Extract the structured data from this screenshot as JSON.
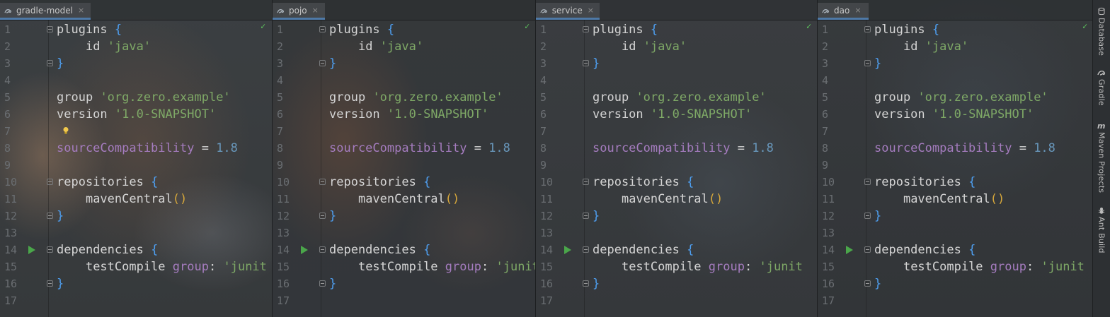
{
  "panes": [
    {
      "tab": "gradle-model",
      "close": "×",
      "show_bulb": true
    },
    {
      "tab": "pojo",
      "close": "×",
      "show_bulb": false
    },
    {
      "tab": "service",
      "close": "×",
      "show_bulb": false
    },
    {
      "tab": "dao",
      "close": "×",
      "show_bulb": false
    }
  ],
  "code": {
    "plugins": "plugins",
    "open_brace": "{",
    "close_brace": "}",
    "id": "id",
    "java": "'java'",
    "group": "group",
    "group_val": "'org.zero.example'",
    "version": "version",
    "version_val": "'1.0-SNAPSHOT'",
    "sourceCompat": "sourceCompatibility",
    "eq": " = ",
    "compat_val": "1.8",
    "repositories": "repositories",
    "mavenCentral": "mavenCentral",
    "lparen": "(",
    "rparen": ")",
    "dependencies": "dependencies",
    "testCompile": "testCompile",
    "group_named": "group",
    "colon": ":",
    "junit_partial": "'junit"
  },
  "line_numbers": [
    "1",
    "2",
    "3",
    "4",
    "5",
    "6",
    "7",
    "8",
    "9",
    "10",
    "11",
    "12",
    "13",
    "14",
    "15",
    "16",
    "17"
  ],
  "sidebar": [
    {
      "label": "Database",
      "icon": "database-icon"
    },
    {
      "label": "Gradle",
      "icon": "gradle-icon"
    },
    {
      "label": "Maven Projects",
      "icon": "maven-icon"
    },
    {
      "label": "Ant Build",
      "icon": "ant-icon"
    }
  ]
}
